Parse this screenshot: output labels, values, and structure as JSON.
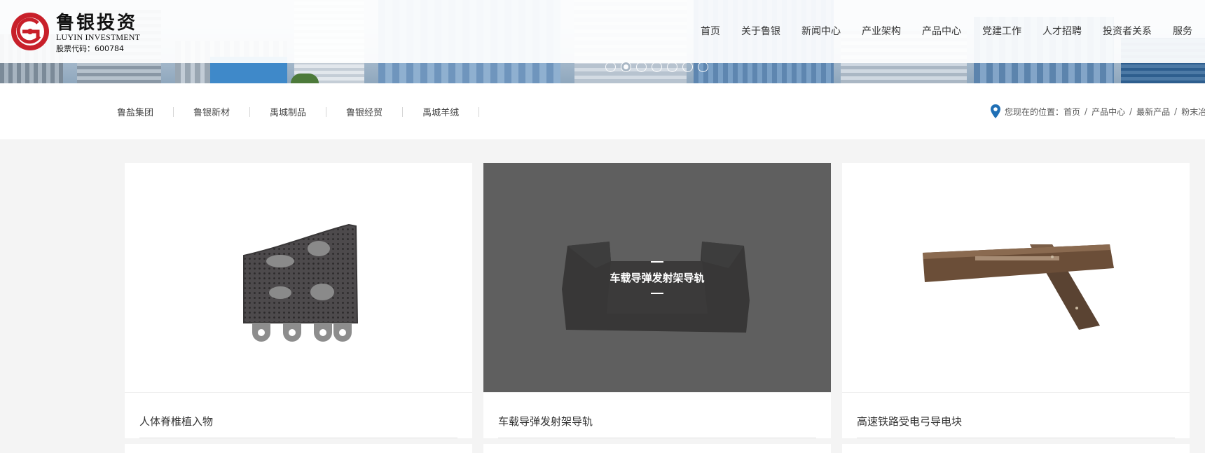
{
  "brand": {
    "name_cn": "鲁银投资",
    "name_en": "LUYIN INVESTMENT",
    "stock_code": "股票代码：600784",
    "colors": {
      "logo_red": "#c8202a",
      "accent_blue": "#1f6fb5",
      "overlay": "#5a5a5a"
    }
  },
  "nav": {
    "items": [
      "首页",
      "关于鲁银",
      "新闻中心",
      "产业架构",
      "产品中心",
      "党建工作",
      "人才招聘",
      "投资者关系",
      "服务"
    ]
  },
  "slider": {
    "dot_count": 7,
    "active_index": 1
  },
  "subnav": {
    "items": [
      "鲁盐集团",
      "鲁银新材",
      "禹城制品",
      "鲁银经贸",
      "禹城羊绒"
    ]
  },
  "location": {
    "icon": "map-pin-icon",
    "label": "您现在的位置：",
    "crumbs": [
      "首页",
      "产品中心",
      "最新产品",
      "粉末冶"
    ]
  },
  "products": [
    {
      "title": "人体脊椎植入物",
      "hovered": false
    },
    {
      "title": "车载导弹发射架导轨",
      "hovered": true,
      "overlay_title": "车载导弹发射架导轨"
    },
    {
      "title": "高速铁路受电弓导电块",
      "hovered": false
    }
  ]
}
